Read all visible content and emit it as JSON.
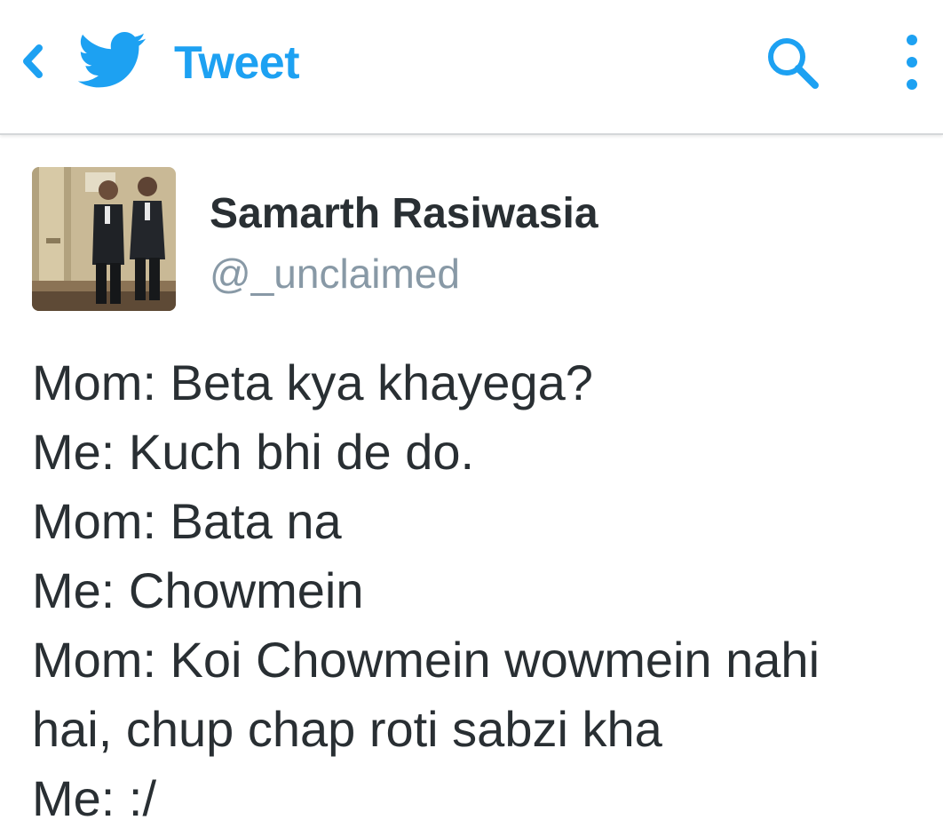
{
  "header": {
    "title": "Tweet",
    "back_icon": "chevron-left-icon",
    "logo_icon": "twitter-bird-icon",
    "search_icon": "search-icon",
    "more_icon": "more-vertical-icon",
    "accent_color": "#1da1f2"
  },
  "tweet": {
    "author": {
      "name": "Samarth Rasiwasia",
      "handle": "@_unclaimed"
    },
    "lines": [
      "Mom: Beta kya khayega?",
      "Me: Kuch bhi de do.",
      "Mom: Bata na",
      "Me: Chowmein",
      "Mom: Koi Chowmein wowmein nahi",
      "hai, chup chap roti sabzi kha",
      "Me: :/"
    ]
  }
}
